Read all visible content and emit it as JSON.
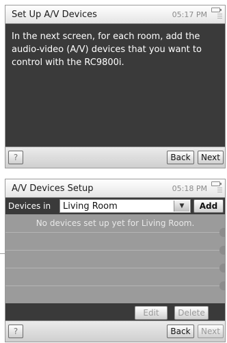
{
  "screen1": {
    "title": "Set Up A/V Devices",
    "time": "05:17 PM",
    "message": "In the next screen, for each room, add the audio-video (A/V) devices that you want to control with the RC9800i.",
    "help_label": "?",
    "back_label": "Back",
    "next_label": "Next"
  },
  "screen2": {
    "title": "A/V Devices Setup",
    "time": "05:18 PM",
    "devices_label": "Devices in",
    "room_value": "Living Room",
    "add_label": "Add",
    "empty_message": "No devices set up yet for Living Room.",
    "edit_label": "Edit",
    "delete_label": "Delete",
    "help_label": "?",
    "back_label": "Back",
    "next_label": "Next"
  },
  "icons": {
    "battery": "battery-icon",
    "menu": "menu-lines-icon",
    "dropdown": "triangle-down-icon"
  },
  "colors": {
    "screen_background": "#3a3a3a",
    "list_background": "#9b9b9b",
    "titlebar": "#f2f2f2"
  }
}
